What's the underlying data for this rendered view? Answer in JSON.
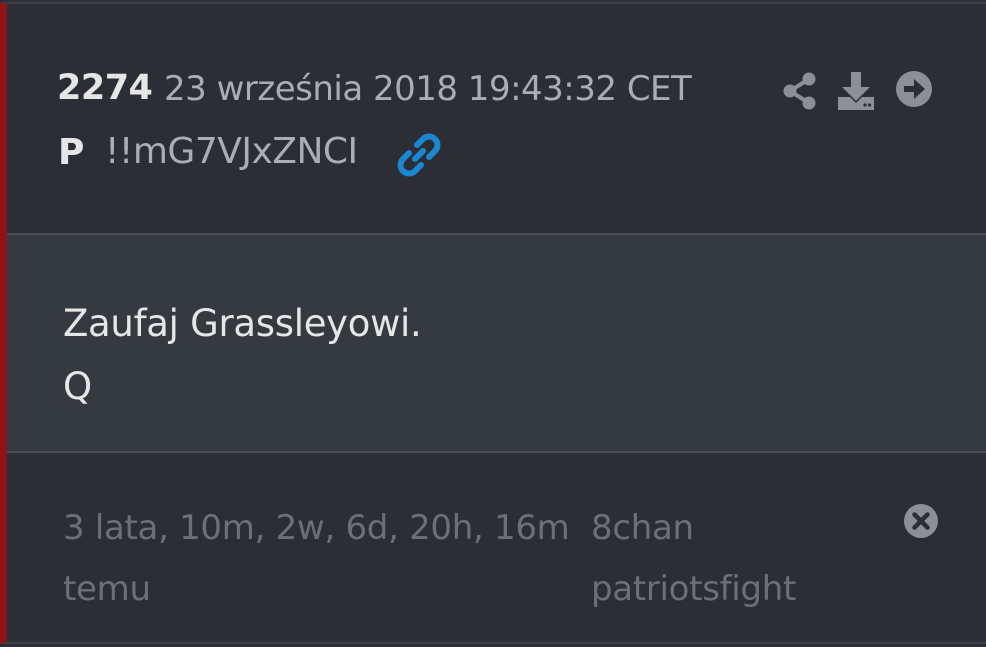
{
  "post": {
    "number": "2274",
    "date": "23 września 2018 19:43:32 CET",
    "author": "P",
    "tripcode": "!!mG7VJxZNCI",
    "body_lines": [
      "Zaufaj Grassleyowi.",
      "Q"
    ],
    "elapsed_line1": "3 lata, 10m, 2w, 6d, 20h, 16m",
    "elapsed_line2": "temu",
    "source_line1": "8chan",
    "source_line2": "patriotsfight"
  },
  "icons": {
    "link": "link-icon",
    "share": "share-icon",
    "download": "download-icon",
    "goto": "arrow-right-circle-icon",
    "close": "close-circle-icon"
  },
  "colors": {
    "accent_border": "#8e1416",
    "link_icon": "#1a87d0",
    "header_bg": "#2b2e34",
    "body_bg": "#353940",
    "footer_text": "#6a6f78"
  }
}
